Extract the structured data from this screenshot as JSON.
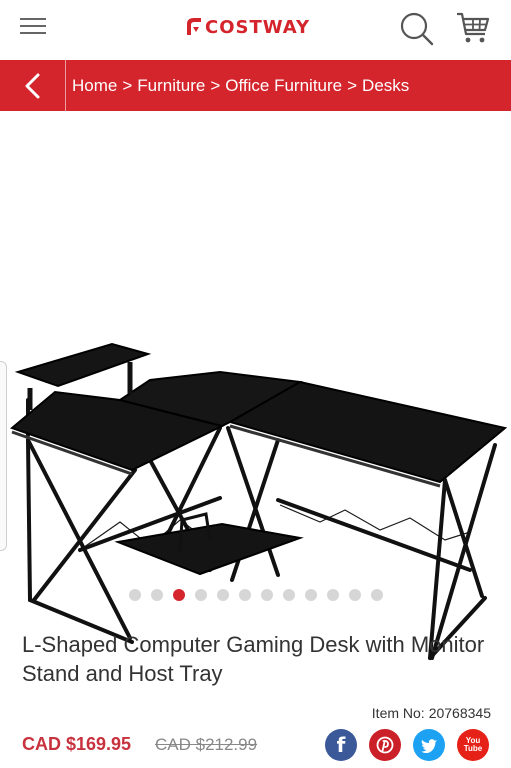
{
  "header": {
    "logo_text": "COSTWAY",
    "brand_color": "#d4242c",
    "icons": [
      "menu-icon",
      "search-icon",
      "cart-icon"
    ]
  },
  "breadcrumb": {
    "back_icon": "chevron-left-icon",
    "items": [
      "Home",
      "Furniture",
      "Office Furniture",
      "Desks"
    ],
    "separator": ">"
  },
  "gallery": {
    "image_count": 12,
    "active_index": 2
  },
  "product": {
    "title": "L-Shaped Computer Gaming Desk with Monitor Stand and Host Tray",
    "item_no_label": "Item No:",
    "item_no": "20768345",
    "price": "CAD $169.95",
    "old_price": "CAD $212.99"
  },
  "share": {
    "icons": [
      "facebook-icon",
      "pinterest-icon",
      "twitter-icon",
      "youtube-icon"
    ],
    "facebook_glyph": "f",
    "youtube_text_top": "You",
    "youtube_text_bottom": "Tube"
  }
}
